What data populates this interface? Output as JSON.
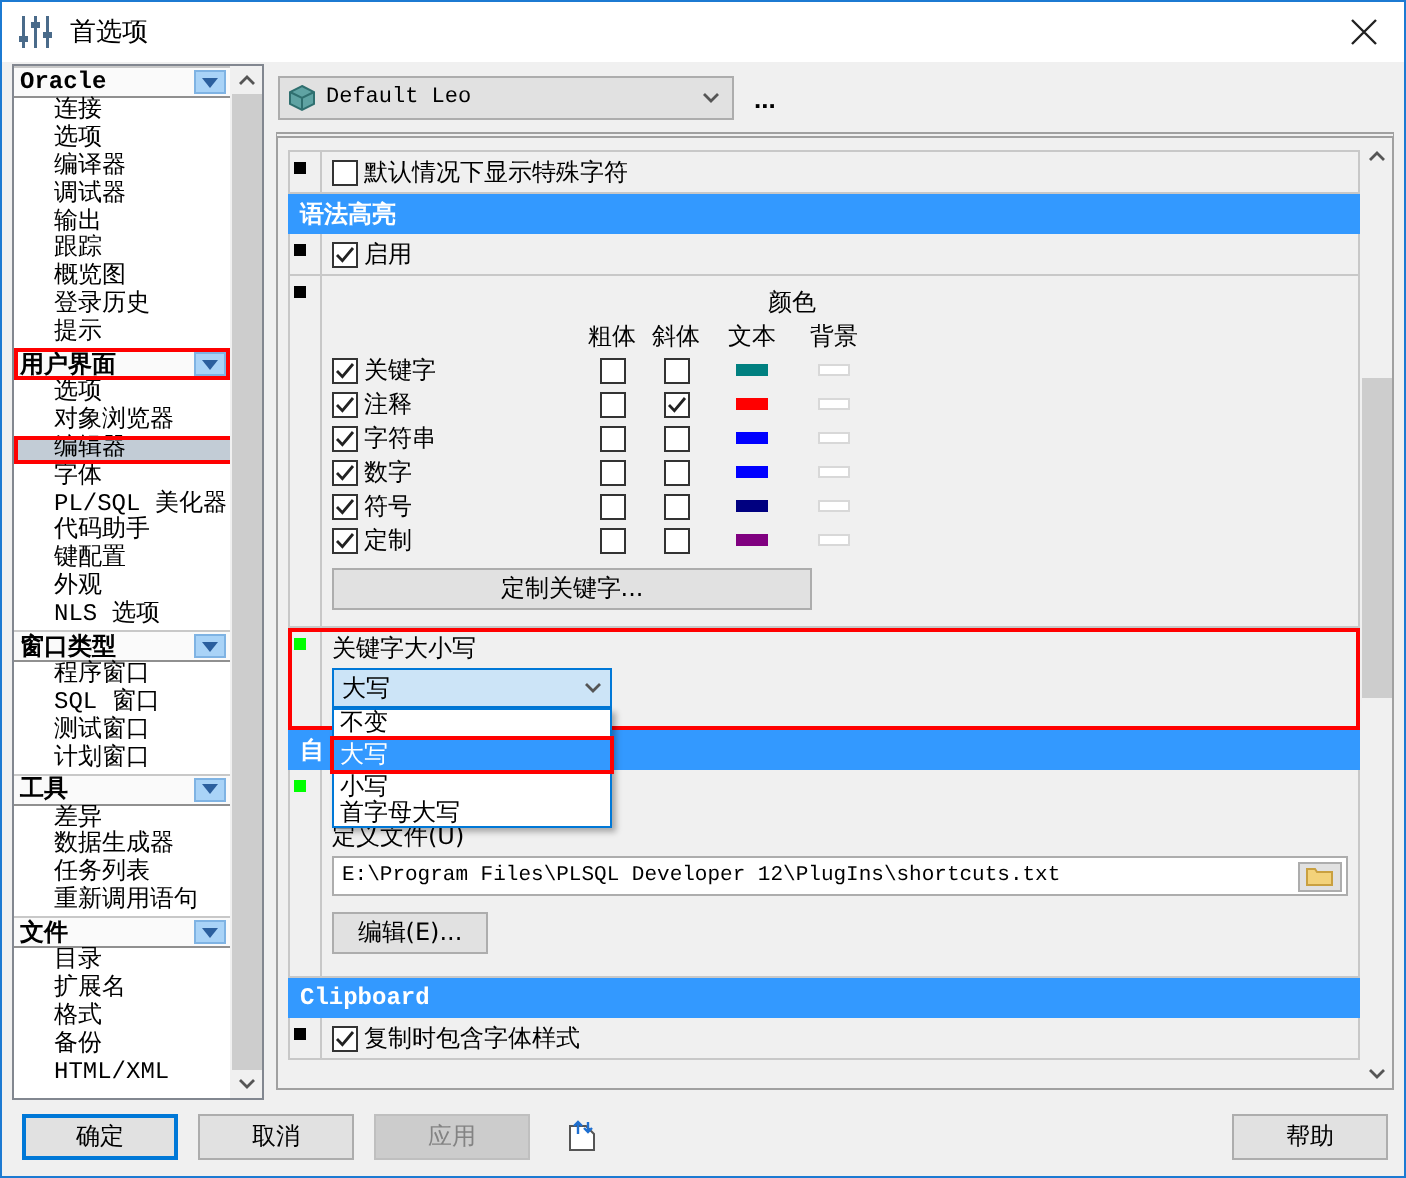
{
  "window": {
    "title": "首选项"
  },
  "sidebar": {
    "groups": [
      {
        "title": "Oracle",
        "annotated": false,
        "items": [
          {
            "label": "连接",
            "selected": false,
            "annotated": false
          },
          {
            "label": "选项",
            "selected": false,
            "annotated": false
          },
          {
            "label": "编译器",
            "selected": false,
            "annotated": false
          },
          {
            "label": "调试器",
            "selected": false,
            "annotated": false
          },
          {
            "label": "输出",
            "selected": false,
            "annotated": false
          },
          {
            "label": "跟踪",
            "selected": false,
            "annotated": false
          },
          {
            "label": "概览图",
            "selected": false,
            "annotated": false
          },
          {
            "label": "登录历史",
            "selected": false,
            "annotated": false
          },
          {
            "label": "提示",
            "selected": false,
            "annotated": false
          }
        ]
      },
      {
        "title": "用户界面",
        "annotated": true,
        "items": [
          {
            "label": "选项",
            "selected": false,
            "annotated": false
          },
          {
            "label": "对象浏览器",
            "selected": false,
            "annotated": false
          },
          {
            "label": "编辑器",
            "selected": true,
            "annotated": true
          },
          {
            "label": "字体",
            "selected": false,
            "annotated": false
          },
          {
            "label": "PL/SQL 美化器",
            "selected": false,
            "annotated": false
          },
          {
            "label": "代码助手",
            "selected": false,
            "annotated": false
          },
          {
            "label": "键配置",
            "selected": false,
            "annotated": false
          },
          {
            "label": "外观",
            "selected": false,
            "annotated": false
          },
          {
            "label": "NLS 选项",
            "selected": false,
            "annotated": false
          }
        ]
      },
      {
        "title": "窗口类型",
        "annotated": false,
        "items": [
          {
            "label": "程序窗口",
            "selected": false,
            "annotated": false
          },
          {
            "label": "SQL 窗口",
            "selected": false,
            "annotated": false
          },
          {
            "label": "测试窗口",
            "selected": false,
            "annotated": false
          },
          {
            "label": "计划窗口",
            "selected": false,
            "annotated": false
          }
        ]
      },
      {
        "title": "工具",
        "annotated": false,
        "items": [
          {
            "label": "差异",
            "selected": false,
            "annotated": false
          },
          {
            "label": "数据生成器",
            "selected": false,
            "annotated": false
          },
          {
            "label": "任务列表",
            "selected": false,
            "annotated": false
          },
          {
            "label": "重新调用语句",
            "selected": false,
            "annotated": false
          }
        ]
      },
      {
        "title": "文件",
        "annotated": false,
        "items": [
          {
            "label": "目录",
            "selected": false,
            "annotated": false
          },
          {
            "label": "扩展名",
            "selected": false,
            "annotated": false
          },
          {
            "label": "格式",
            "selected": false,
            "annotated": false
          },
          {
            "label": "备份",
            "selected": false,
            "annotated": false
          },
          {
            "label": "HTML/XML",
            "selected": false,
            "annotated": false
          }
        ]
      }
    ]
  },
  "profile": {
    "value": "Default Leo",
    "more": "..."
  },
  "panel": [
    {
      "kind": "checkbox",
      "marker": {
        "color": "#000000"
      },
      "label": "默认情况下显示特殊字符",
      "checked": false
    },
    {
      "kind": "header",
      "title": "语法高亮"
    },
    {
      "kind": "checkbox",
      "marker": {
        "color": "#000000"
      },
      "label": "启用",
      "checked": true
    },
    {
      "kind": "highlight",
      "marker": {
        "color": "#000000"
      },
      "color_heading": "颜色",
      "columns": [
        "粗体",
        "斜体",
        "文本",
        "背景"
      ],
      "button": "定制关键字...",
      "rows": [
        {
          "label": "关键字",
          "enabled": true,
          "bold": false,
          "italic": false,
          "text_swatch": {
            "color": "#008080"
          },
          "bg_swatch": {
            "color": "#ffffff"
          }
        },
        {
          "label": "注释",
          "enabled": true,
          "bold": false,
          "italic": true,
          "text_swatch": {
            "color": "#ff0000"
          },
          "bg_swatch": {
            "color": "#ffffff"
          }
        },
        {
          "label": "字符串",
          "enabled": true,
          "bold": false,
          "italic": false,
          "text_swatch": {
            "color": "#0000ff"
          },
          "bg_swatch": {
            "color": "#ffffff"
          }
        },
        {
          "label": "数字",
          "enabled": true,
          "bold": false,
          "italic": false,
          "text_swatch": {
            "color": "#0000ff"
          },
          "bg_swatch": {
            "color": "#ffffff"
          }
        },
        {
          "label": "符号",
          "enabled": true,
          "bold": false,
          "italic": false,
          "text_swatch": {
            "color": "#000080"
          },
          "bg_swatch": {
            "color": "#ffffff"
          }
        },
        {
          "label": "定制",
          "enabled": true,
          "bold": false,
          "italic": false,
          "text_swatch": {
            "color": "#800080"
          },
          "bg_swatch": {
            "color": "#ffffff"
          }
        }
      ]
    },
    {
      "kind": "select",
      "marker": {
        "color": "#00ff00"
      },
      "label": "关键字大小写",
      "value": "大写",
      "open": true,
      "annotated": true,
      "options": [
        {
          "label": "不变",
          "selected": false,
          "annotated": false
        },
        {
          "label": "大写",
          "selected": true,
          "annotated": true
        },
        {
          "label": "小写",
          "selected": false,
          "annotated": false
        },
        {
          "label": "首字母大写",
          "selected": false,
          "annotated": false
        }
      ]
    },
    {
      "kind": "header",
      "title": "自"
    },
    {
      "kind": "file",
      "marker": {
        "color": "#00ff00"
      },
      "label": "定义文件(U)",
      "path": "E:\\Program Files\\PLSQL Developer 12\\PlugIns\\shortcuts.txt",
      "button": "编辑(E)..."
    },
    {
      "kind": "header",
      "title": "Clipboard"
    },
    {
      "kind": "checkbox",
      "marker": {
        "color": "#000000"
      },
      "label": "复制时包含字体样式",
      "checked": true
    }
  ],
  "buttons": [
    {
      "label": "确定",
      "default": true,
      "disabled": false
    },
    {
      "label": "取消",
      "default": false,
      "disabled": false
    },
    {
      "label": "应用",
      "default": false,
      "disabled": true
    }
  ],
  "help_button": "帮助"
}
